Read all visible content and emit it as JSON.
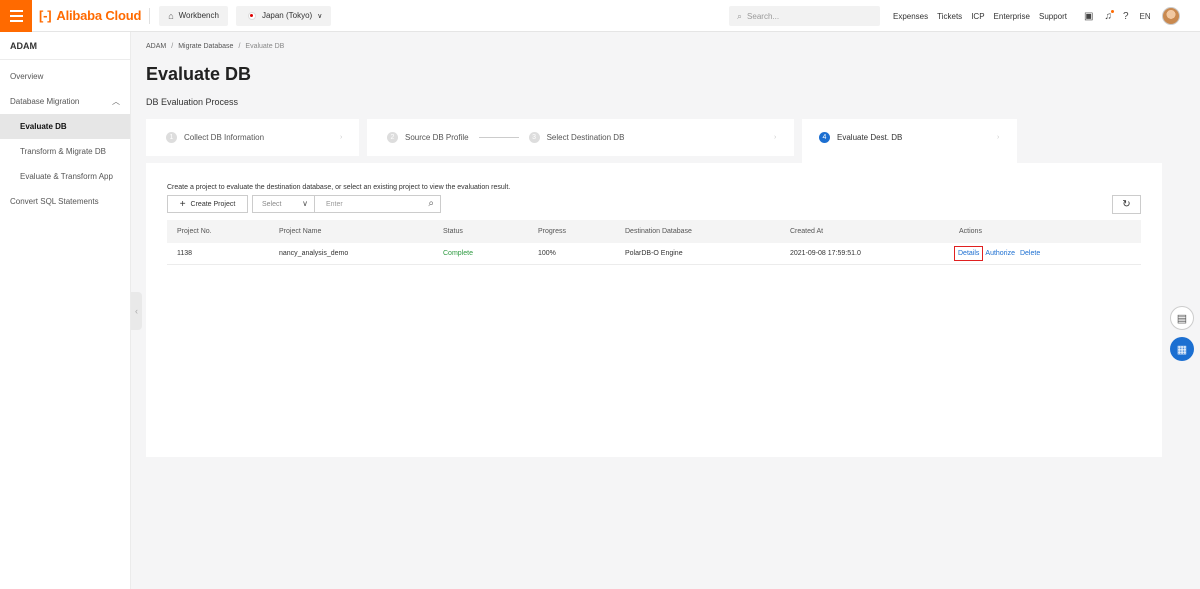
{
  "topbar": {
    "brand": "Alibaba Cloud",
    "workbench": "Workbench",
    "region": "Japan (Tokyo)",
    "search_placeholder": "Search...",
    "links": [
      "Expenses",
      "Tickets",
      "ICP",
      "Enterprise",
      "Support"
    ],
    "language": "EN"
  },
  "sidebar": {
    "title": "ADAM",
    "items": [
      {
        "label": "Overview"
      },
      {
        "label": "Database Migration"
      },
      {
        "label": "Evaluate DB"
      },
      {
        "label": "Transform & Migrate DB"
      },
      {
        "label": "Evaluate & Transform App"
      },
      {
        "label": "Convert SQL Statements"
      }
    ]
  },
  "breadcrumb": {
    "items": [
      "ADAM",
      "Migrate Database",
      "Evaluate DB"
    ]
  },
  "page": {
    "title": "Evaluate DB",
    "subtitle": "DB Evaluation Process"
  },
  "steps": [
    {
      "num": "1",
      "label": "Collect DB Information"
    },
    {
      "num": "2",
      "label": "Source DB Profile"
    },
    {
      "num": "3",
      "label": "Select Destination DB"
    },
    {
      "num": "4",
      "label": "Evaluate Dest. DB"
    }
  ],
  "panel": {
    "description": "Create a project to evaluate the destination database, or select an existing project to view the evaluation result.",
    "create_label": "Create Project",
    "select_placeholder": "Select",
    "input_placeholder": "Enter"
  },
  "table": {
    "headers": [
      "Project No.",
      "Project Name",
      "Status",
      "Progress",
      "Destination Database",
      "Created At",
      "Actions"
    ],
    "rows": [
      {
        "project_no": "1138",
        "project_name": "nancy_analysis_demo",
        "status": "Complete",
        "progress": "100%",
        "destination": "PolarDB-O Engine",
        "created_at": "2021-09-08 17:59:51.0",
        "actions": [
          "Details",
          "Authorize",
          "Delete"
        ]
      }
    ]
  },
  "colors": {
    "brand": "#ff6a00",
    "link": "#1c6fd1",
    "success": "#2e9a40",
    "highlight": "#e02020"
  }
}
